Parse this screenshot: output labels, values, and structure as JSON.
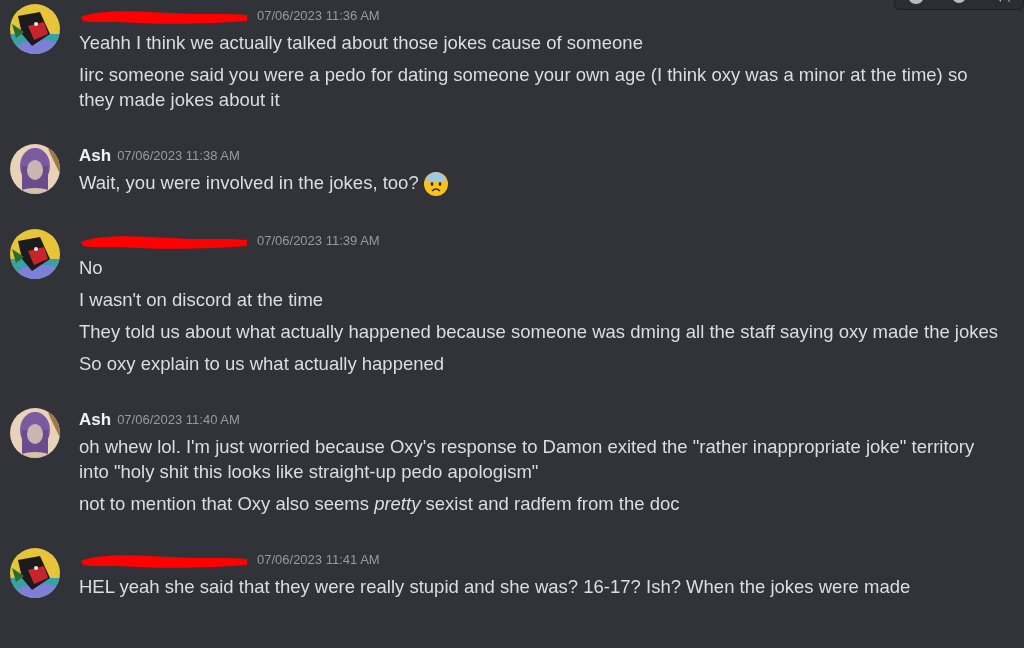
{
  "groups": [
    {
      "author": {
        "kind": "redacted"
      },
      "timestamp": "07/06/2023 11:36 AM",
      "messages": [
        {
          "text": "Yeahh I think we actually talked about those jokes cause of someone",
          "kind": "text"
        },
        {
          "text": "Iirc someone said you were a pedo for dating someone your own age (I think oxy was a minor at the time) so they made jokes about it",
          "kind": "text"
        }
      ]
    },
    {
      "author": {
        "kind": "named",
        "name": "Ash"
      },
      "timestamp": "07/06/2023 11:38 AM",
      "messages": [
        {
          "text": "Wait, you were involved in the jokes, too?",
          "kind": "text_emoji"
        }
      ]
    },
    {
      "author": {
        "kind": "redacted"
      },
      "timestamp": "07/06/2023 11:39 AM",
      "messages": [
        {
          "text": "No",
          "kind": "text"
        },
        {
          "text": "I wasn't on discord at the time",
          "kind": "text"
        },
        {
          "text": "They told us about what actually happened because someone was dming all the staff saying oxy made the jokes",
          "kind": "text"
        },
        {
          "text": "So oxy explain to us what actually happened",
          "kind": "text"
        }
      ]
    },
    {
      "author": {
        "kind": "named",
        "name": "Ash"
      },
      "timestamp": "07/06/2023 11:40 AM",
      "messages": [
        {
          "text": "oh whew lol. I'm just worried because Oxy's response to Damon exited the \"rather inappropriate joke\" territory into \"holy shit this looks like straight-up pedo apologism\"",
          "kind": "text"
        },
        {
          "text": "not to mention that Oxy also seems *pretty* sexist and radfem from the doc",
          "kind": "text"
        }
      ]
    },
    {
      "author": {
        "kind": "redacted"
      },
      "timestamp": "07/06/2023 11:41 AM",
      "messages": [
        {
          "text": "HEL yeah she said that they were really stupid and she was? 16-17? Ish? When the jokes were made",
          "kind": "text"
        }
      ]
    }
  ]
}
